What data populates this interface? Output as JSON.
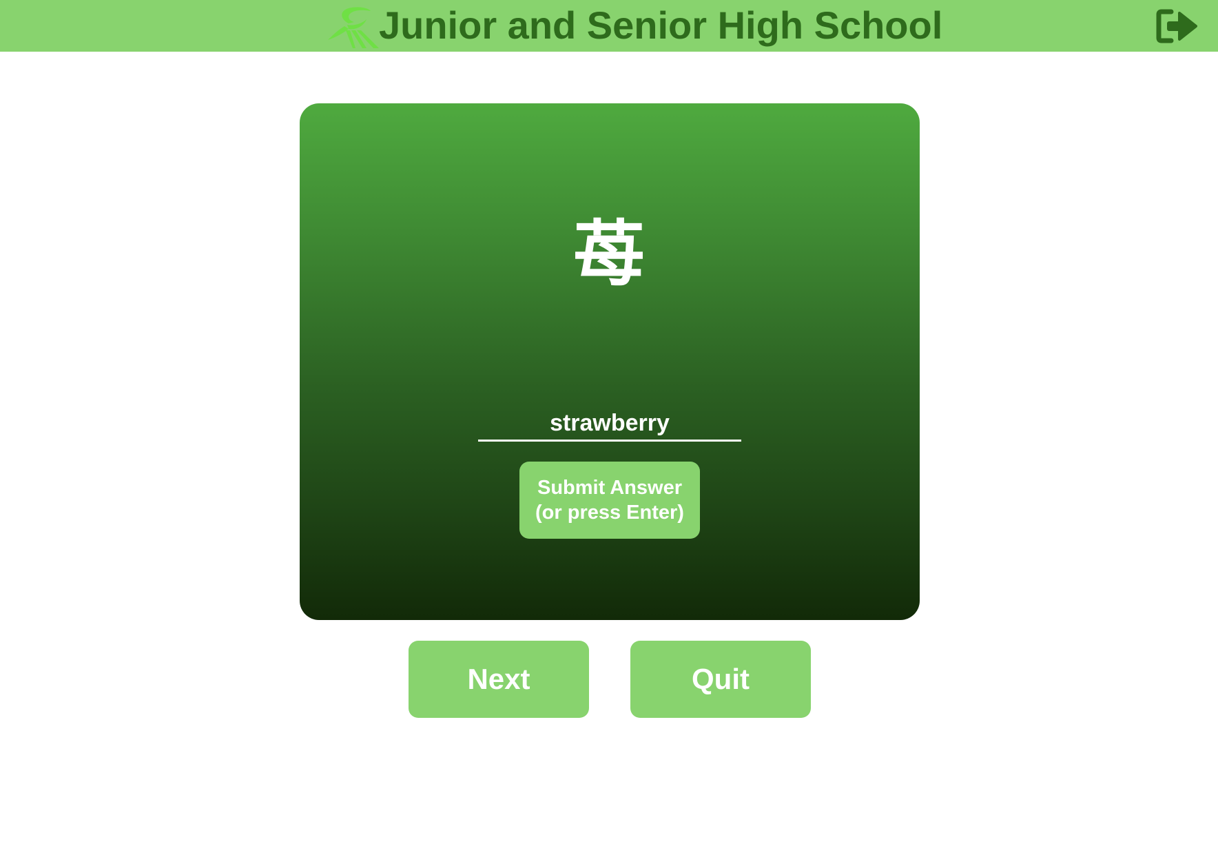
{
  "header": {
    "title": "Junior and Senior High School",
    "logo_icon": "school-wing-logo",
    "logout_icon": "sign-out-icon",
    "background_color": "#88d36e",
    "title_color": "#2e6b1c"
  },
  "card": {
    "kanji": "苺",
    "answer_value": "strawberry",
    "submit_label": "Submit Answer (or press Enter)",
    "gradient_top": "#4faa3f",
    "gradient_bottom": "#122a08"
  },
  "actions": {
    "next_label": "Next",
    "quit_label": "Quit",
    "button_color": "#88d36e"
  }
}
